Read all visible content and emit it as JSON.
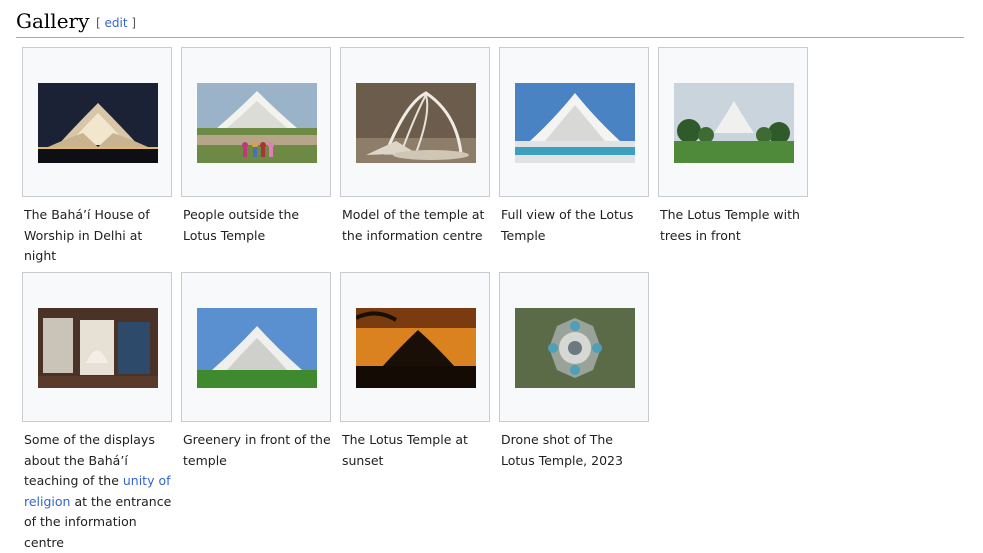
{
  "heading": {
    "title": "Gallery",
    "edit_open": "[ ",
    "edit_label": "edit",
    "edit_close": " ]"
  },
  "items": [
    {
      "caption": "The Bahá’í House of Worship in Delhi at night"
    },
    {
      "caption": "People outside the Lotus Temple"
    },
    {
      "caption": "Model of the temple at the information centre"
    },
    {
      "caption": "Full view of the Lotus Temple"
    },
    {
      "caption": "The Lotus Temple with trees in front"
    },
    {
      "caption_pre": "Some of the displays about the Bahá’í teaching of the ",
      "caption_link": "unity of religion",
      "caption_post": " at the entrance of the information centre"
    },
    {
      "caption": "Greenery in front of the temple"
    },
    {
      "caption": "The Lotus Temple at sunset"
    },
    {
      "caption": "Drone shot of The Lotus Temple, 2023"
    }
  ]
}
